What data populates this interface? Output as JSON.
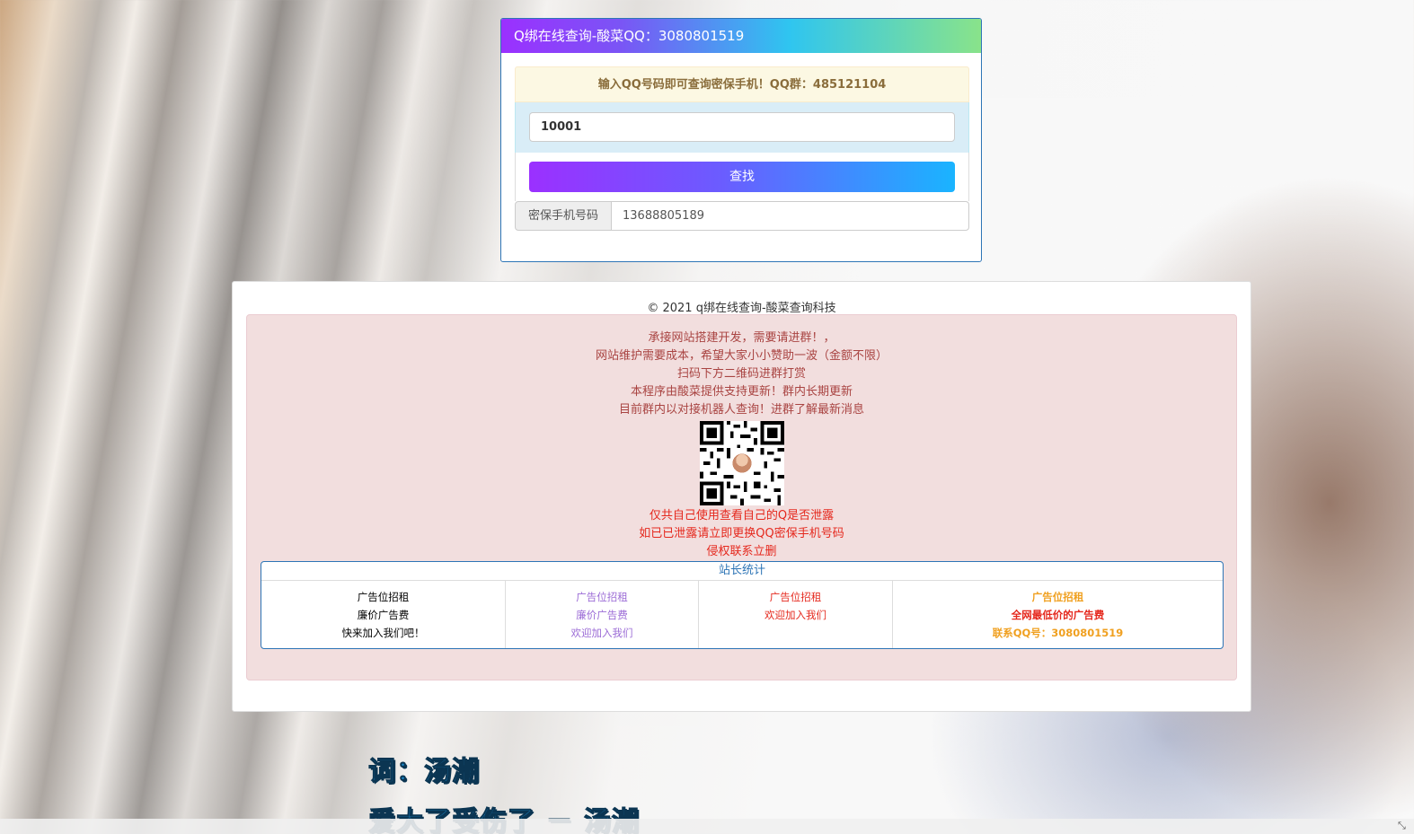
{
  "query": {
    "title": "Q绑在线查询-酸菜QQ：3080801519",
    "tip": "输入QQ号码即可查询密保手机！QQ群：485121104",
    "input_value": "10001",
    "search_label": "查找",
    "result_label": "密保手机号码",
    "result_value": "13688805189"
  },
  "footer": {
    "copyright": "© 2021  q绑在线查询-酸菜查询科技",
    "notice": [
      "承接网站搭建开发，需要请进群！，",
      "网站维护需要成本，希望大家小小赞助一波（金额不限）",
      "扫码下方二维码进群打赏",
      "本程序由酸菜提供支持更新！群内长期更新",
      "目前群内以对接机器人查询！进群了解最新消息"
    ],
    "warnings": [
      "仅共自己使用查看自己的Q是否泄露",
      "如已已泄露请立即更换QQ密保手机号码",
      "侵权联系立删"
    ],
    "stats_title": "站长统计",
    "ads": [
      [
        "广告位招租",
        "廉价广告费",
        "快来加入我们吧！"
      ],
      [
        "广告位招租",
        "廉价广告费",
        "欢迎加入我们"
      ],
      [
        "广告位招租",
        "欢迎加入我们"
      ],
      [
        "广告位招租",
        "全网最低价的广告费",
        "联系QQ号：3080801519"
      ]
    ]
  },
  "lyrics": {
    "line1": "词：汤潮",
    "line2": "爱大了受伤了 － 汤潮"
  },
  "colors": {
    "header_gradient_start": "#9b30ff",
    "header_gradient_end": "#89e38a",
    "panel_border": "#2e75b6",
    "notice_text": "#a94442",
    "warning_text": "#e5281d"
  }
}
